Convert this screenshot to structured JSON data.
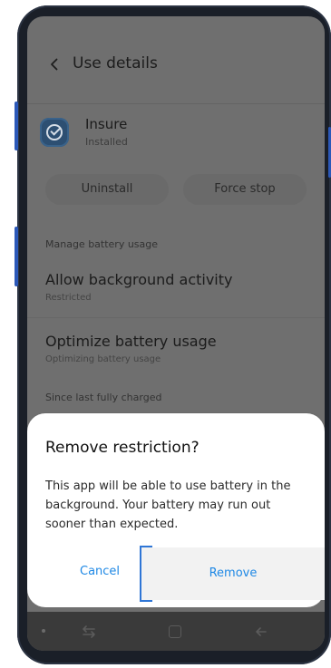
{
  "header": {
    "title": "Use details",
    "back_icon": "chevron-left-icon"
  },
  "app": {
    "name": "Insure",
    "status": "Installed",
    "icon": "shield-check-icon"
  },
  "actions": {
    "uninstall_label": "Uninstall",
    "force_stop_label": "Force stop"
  },
  "battery": {
    "section_label": "Manage battery usage",
    "allow_background": {
      "title": "Allow background activity",
      "subtitle": "Restricted"
    },
    "optimize": {
      "title": "Optimize battery usage",
      "subtitle": "Optimizing battery usage"
    },
    "since_label": "Since last fully charged"
  },
  "dialog": {
    "title": "Remove restriction?",
    "body": "This app will be able to use battery in the background. Your battery may run out sooner than expected.",
    "cancel_label": "Cancel",
    "remove_label": "Remove"
  },
  "nav": {
    "recent_icon": "recent-apps-icon",
    "home_icon": "home-icon",
    "back_icon": "back-arrow-icon"
  },
  "colors": {
    "accent": "#1e88e5",
    "dim_overlay": "#6f6f6f",
    "phone_frame": "#1a1f28"
  }
}
